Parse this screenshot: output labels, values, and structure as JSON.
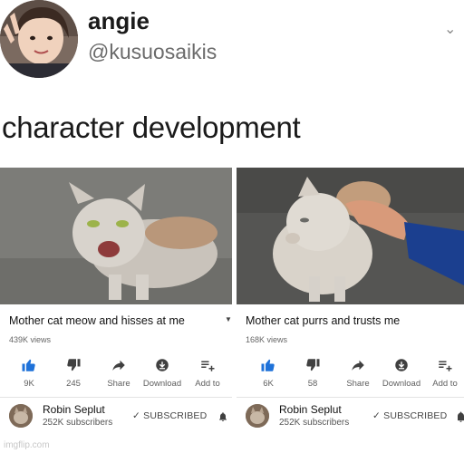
{
  "tweet": {
    "name": "angie",
    "handle": "@kusuosaikis",
    "text": "character development"
  },
  "cards": [
    {
      "title": "Mother cat meow and hisses at me",
      "views": "439K views",
      "actions": {
        "like": "9K",
        "dislike": "245",
        "share": "Share",
        "download": "Download",
        "add": "Add to"
      },
      "channel": {
        "name": "Robin Seplut",
        "subscribers": "252K subscribers",
        "status": "SUBSCRIBED"
      }
    },
    {
      "title": "Mother cat purrs and trusts me",
      "views": "168K views",
      "actions": {
        "like": "6K",
        "dislike": "58",
        "share": "Share",
        "download": "Download",
        "add": "Add to"
      },
      "channel": {
        "name": "Robin Seplut",
        "subscribers": "252K subscribers",
        "status": "SUBSCRIBED"
      }
    }
  ],
  "watermark": "imgflip.com",
  "colors": {
    "accent_blue": "#1f72d9",
    "icon_dark": "#404040",
    "text_gray": "#606060"
  },
  "icons": [
    "like-icon",
    "dislike-icon",
    "share-icon",
    "download-icon",
    "add-to-playlist-icon",
    "check-icon",
    "bell-icon",
    "chevron-down-icon"
  ]
}
